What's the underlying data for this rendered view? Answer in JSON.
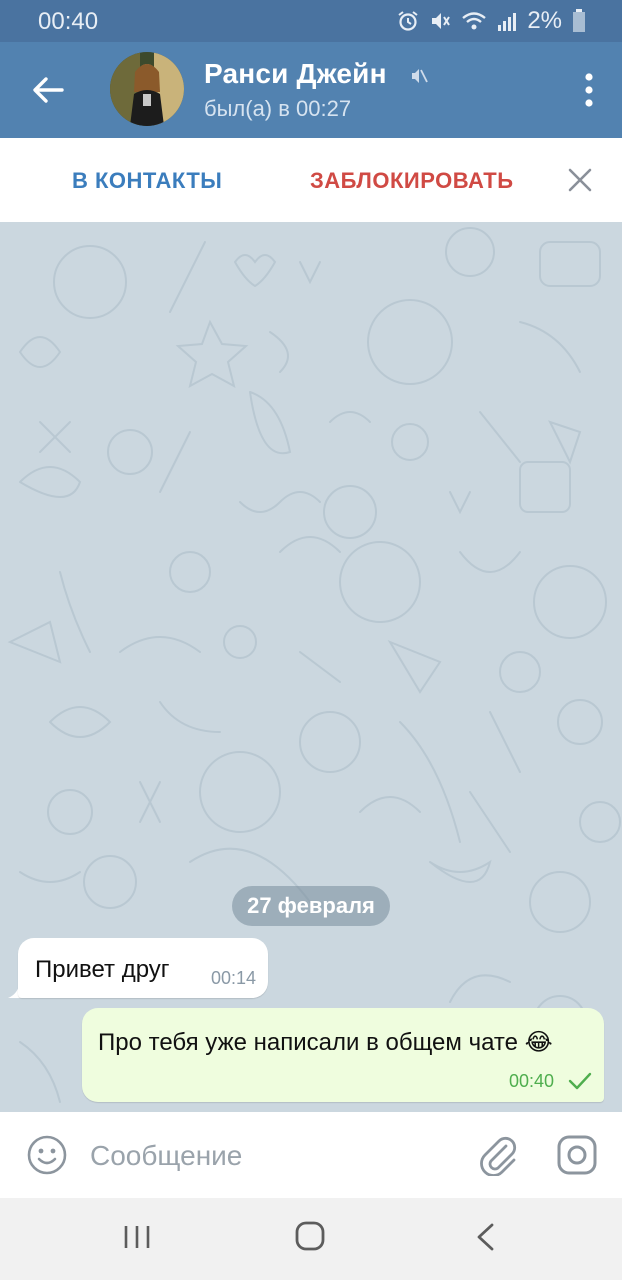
{
  "status_bar": {
    "time": "00:40",
    "battery": "2%",
    "icons": [
      "alarm-icon",
      "mute-icon",
      "wifi-icon",
      "signal-icon",
      "battery-icon"
    ]
  },
  "header": {
    "contact_name": "Ранси Джейн",
    "last_seen": "был(а) в 00:27",
    "muted": true
  },
  "action_bar": {
    "add_contact": "В КОНТАКТЫ",
    "block": "ЗАБЛОКИРОВАТЬ"
  },
  "chat": {
    "date_separator": "27 февраля",
    "messages": [
      {
        "direction": "incoming",
        "text": "Привет друг",
        "time": "00:14"
      },
      {
        "direction": "outgoing",
        "text": "Про тебя уже написали в общем чате 😂",
        "time": "00:40",
        "status": "sent"
      }
    ]
  },
  "composer": {
    "placeholder": "Сообщение"
  },
  "colors": {
    "header": "#5282b0",
    "status_bar": "#4a73a0",
    "add_contact": "#3b7dbd",
    "block": "#d04a44",
    "chat_background": "#cbd7df",
    "outgoing_bubble": "#effdde",
    "outgoing_time": "#4fae4e"
  }
}
